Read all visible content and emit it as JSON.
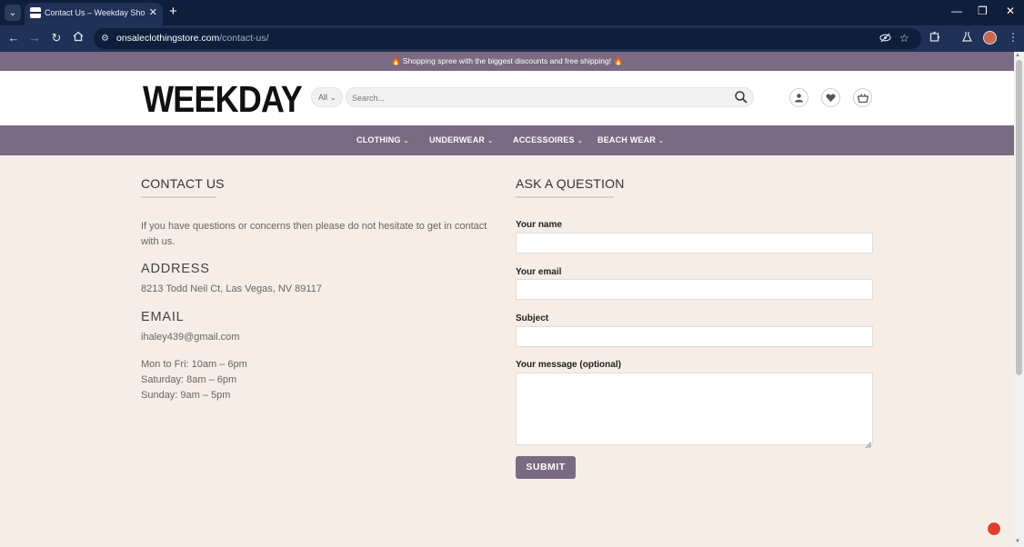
{
  "browser": {
    "tab_title": "Contact Us – Weekday Shop – h",
    "url_host": "onsaleclothingstore.com",
    "url_path": "/contact-us/",
    "icons": [
      "tab-search-icon",
      "close-icon",
      "new-tab-icon",
      "minimize-icon",
      "restore-icon",
      "window-close-icon",
      "back-icon",
      "forward-icon",
      "reload-icon",
      "home-icon",
      "site-info-icon",
      "eye-off-icon",
      "star-icon",
      "extensions-icon",
      "labs-icon",
      "profile-avatar",
      "menu-icon"
    ]
  },
  "announcement": "🔥 Shopping spree with the biggest discounts and free shipping! 🔥",
  "header": {
    "logo": "WEEKDAY",
    "category_select": "All",
    "search_placeholder": "Search...",
    "icons": [
      "search-icon",
      "account-icon",
      "wishlist-icon",
      "cart-icon"
    ]
  },
  "nav": {
    "items": [
      {
        "label": "CLOTHING"
      },
      {
        "label": "UNDERWEAR"
      },
      {
        "label": "ACCESSOIRES"
      },
      {
        "label": "BEACH WEAR"
      }
    ]
  },
  "contact": {
    "title": "CONTACT US",
    "intro": "If you have questions or concerns then please do not hesitate to get in contact with us.",
    "address_heading": "ADDRESS",
    "address": "8213 Todd Neil Ct, Las Vegas, NV 89117",
    "email_heading": "EMAIL",
    "email": "ihaley439@gmail.com",
    "hours": [
      "Mon to Fri: 10am – 6pm",
      "Saturday: 8am – 6pm",
      "Sunday: 9am – 5pm"
    ]
  },
  "form": {
    "title": "ASK A QUESTION",
    "name_label": "Your name",
    "email_label": "Your email",
    "subject_label": "Subject",
    "message_label": "Your message (optional)",
    "submit_label": "SUBMIT"
  },
  "colors": {
    "accent": "#7a6a82",
    "page_bg": "#f5ede6",
    "browser_dark": "#0f1e3a",
    "browser_toolbar": "#1f3157"
  }
}
